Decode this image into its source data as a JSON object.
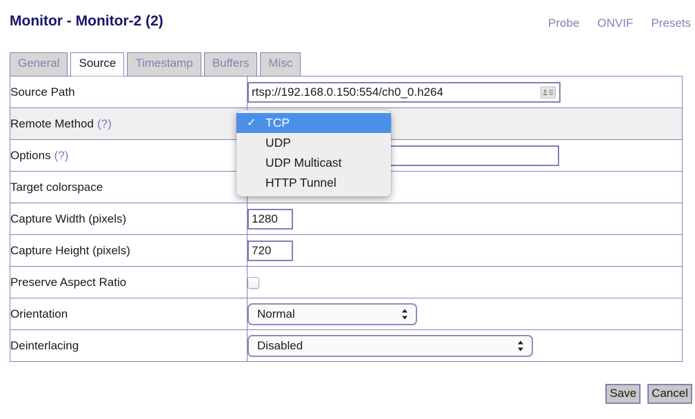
{
  "header": {
    "title": "Monitor - Monitor-2 (2)",
    "links": [
      {
        "label": "Probe",
        "name": "probe-link"
      },
      {
        "label": "ONVIF",
        "name": "onvif-link"
      },
      {
        "label": "Presets",
        "name": "presets-link"
      }
    ]
  },
  "tabs": [
    {
      "label": "General",
      "active": false
    },
    {
      "label": "Source",
      "active": true
    },
    {
      "label": "Timestamp",
      "active": false
    },
    {
      "label": "Buffers",
      "active": false
    },
    {
      "label": "Misc",
      "active": false
    }
  ],
  "rows": {
    "source_path": {
      "label": "Source Path",
      "value": "rtsp://192.168.0.150:554/ch0_0.h264",
      "icon": "contact-card-icon"
    },
    "remote_method": {
      "label": "Remote Method (?)",
      "label_text": "Remote Method",
      "help": "(?)",
      "selected": "TCP"
    },
    "options": {
      "label": "Options (?)",
      "label_text": "Options",
      "help": "(?)",
      "value": "",
      "placeholder": ""
    },
    "target_colorspace": {
      "label": "Target colorspace",
      "value": ""
    },
    "capture_width": {
      "label": "Capture Width (pixels)",
      "value": "1280"
    },
    "capture_height": {
      "label": "Capture Height (pixels)",
      "value": "720"
    },
    "preserve_aspect_ratio": {
      "label": "Preserve Aspect Ratio",
      "checked": false
    },
    "orientation": {
      "label": "Orientation",
      "value": "Normal"
    },
    "deinterlacing": {
      "label": "Deinterlacing",
      "value": "Disabled"
    }
  },
  "remote_method_popup": {
    "items": [
      {
        "label": "TCP",
        "selected": true
      },
      {
        "label": "UDP",
        "selected": false
      },
      {
        "label": "UDP Multicast",
        "selected": false
      },
      {
        "label": "HTTP Tunnel",
        "selected": false
      }
    ],
    "checkmark": "✓"
  },
  "buttons": {
    "save": "Save",
    "cancel": "Cancel"
  },
  "colors": {
    "title": "#16166b",
    "border": "#8080b8",
    "link": "#8080b8",
    "highlight": "#4a90e8",
    "tab_inactive_bg": "#d6d6d6",
    "row_hover_bg": "#efefef",
    "button_bg": "#c9c9c9"
  }
}
